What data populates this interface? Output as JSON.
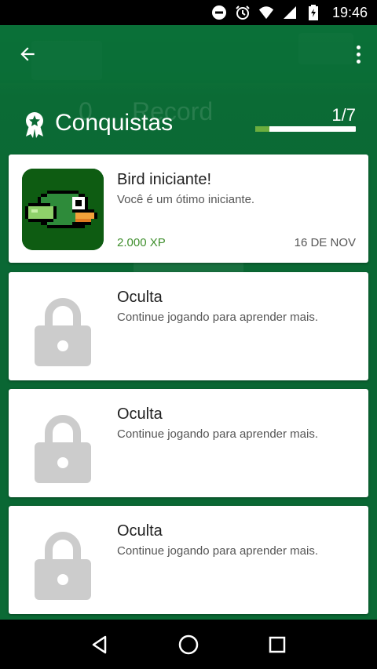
{
  "status_bar": {
    "time": "19:46",
    "icons": [
      "do-not-disturb-icon",
      "alarm-icon",
      "wifi-icon",
      "cell-signal-icon",
      "battery-icon"
    ]
  },
  "toolbar": {
    "back_icon": "arrow-back-icon",
    "menu_icon": "more-vert-icon"
  },
  "background": {
    "ghost_score": "0",
    "ghost_record": "Record"
  },
  "header": {
    "title": "Conquistas",
    "progress_text": "1/7",
    "progress_fraction": 0.14,
    "icon": "award-ribbon-icon"
  },
  "achievements": [
    {
      "title": "Bird iniciante!",
      "description": "Você é um ótimo iniciante.",
      "xp": "2.000 XP",
      "date": "16 DE NOV",
      "unlocked": true,
      "icon": "pixel-bird-icon"
    },
    {
      "title": "Oculta",
      "description": "Continue jogando para aprender mais.",
      "unlocked": false,
      "icon": "lock-icon"
    },
    {
      "title": "Oculta",
      "description": "Continue jogando para aprender mais.",
      "unlocked": false,
      "icon": "lock-icon"
    },
    {
      "title": "Oculta",
      "description": "Continue jogando para aprender mais.",
      "unlocked": false,
      "icon": "lock-icon"
    }
  ],
  "navbar": {
    "icons": [
      "back-triangle-icon",
      "home-circle-icon",
      "recents-square-icon"
    ]
  },
  "colors": {
    "app_green": "#0c6a36",
    "progress_fill": "#6cae3e",
    "xp_green": "#3f8f2d",
    "lock_gray": "#cccccc",
    "bird_bg": "#0e5c12"
  }
}
